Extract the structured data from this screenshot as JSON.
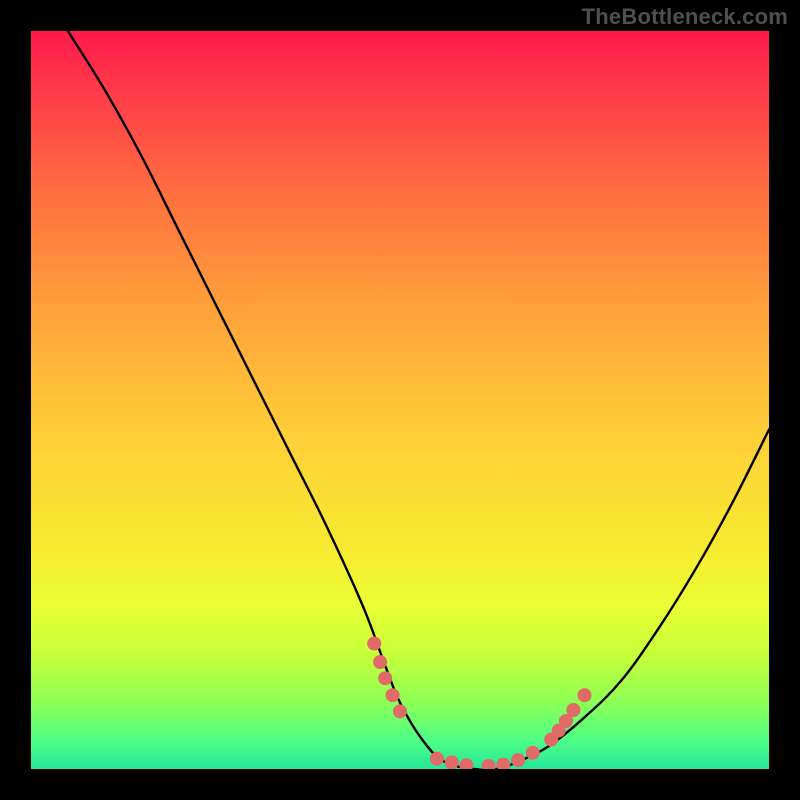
{
  "watermark": "TheBottleneck.com",
  "chart_data": {
    "type": "line",
    "title": "",
    "xlabel": "",
    "ylabel": "",
    "xlim": [
      0,
      100
    ],
    "ylim": [
      0,
      100
    ],
    "grid": false,
    "series": [
      {
        "name": "bottleneck-curve",
        "x": [
          5,
          10,
          15,
          20,
          25,
          30,
          35,
          40,
          45,
          48,
          50,
          53,
          56,
          60,
          63,
          66,
          70,
          75,
          80,
          85,
          90,
          95,
          100
        ],
        "y": [
          100,
          92,
          83,
          73,
          63,
          53,
          43,
          33,
          22,
          14,
          9,
          4,
          1,
          0,
          0,
          1,
          3,
          7,
          12,
          19,
          27,
          36,
          46
        ]
      }
    ],
    "markers": {
      "name": "highlight-dots",
      "color": "#e06a66",
      "points": [
        {
          "x": 46.5,
          "y": 17
        },
        {
          "x": 47.3,
          "y": 14.5
        },
        {
          "x": 48.0,
          "y": 12.3
        },
        {
          "x": 49.0,
          "y": 10.0
        },
        {
          "x": 50.0,
          "y": 7.8
        },
        {
          "x": 55.0,
          "y": 1.4
        },
        {
          "x": 57.0,
          "y": 0.9
        },
        {
          "x": 59.0,
          "y": 0.5
        },
        {
          "x": 62.0,
          "y": 0.4
        },
        {
          "x": 64.0,
          "y": 0.6
        },
        {
          "x": 66.0,
          "y": 1.2
        },
        {
          "x": 68.0,
          "y": 2.2
        },
        {
          "x": 70.5,
          "y": 4.0
        },
        {
          "x": 71.5,
          "y": 5.2
        },
        {
          "x": 72.5,
          "y": 6.5
        },
        {
          "x": 73.5,
          "y": 8.0
        },
        {
          "x": 75.0,
          "y": 10.0
        }
      ]
    },
    "background_gradient": {
      "top": "#ff1a4b",
      "mid": "#f7ea30",
      "bottom": "#28e69a"
    }
  }
}
